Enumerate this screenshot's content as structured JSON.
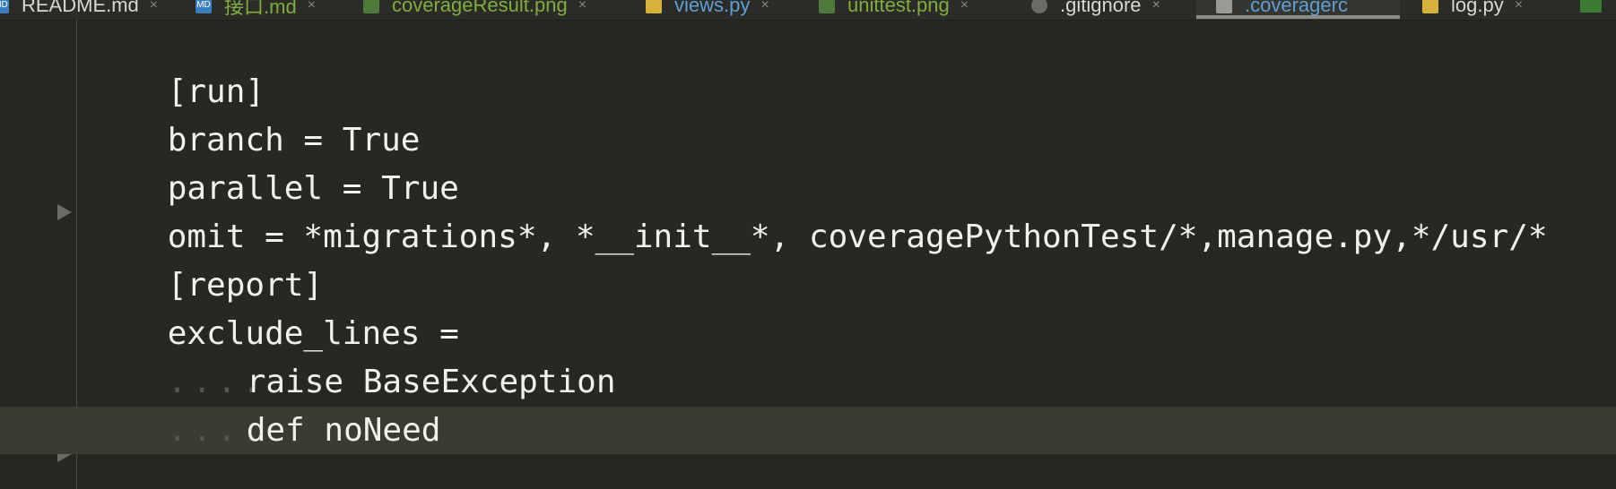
{
  "tabs": [
    {
      "label": "README.md",
      "icon": "markdown-icon",
      "icon_text": "MD",
      "style": "plain"
    },
    {
      "label": "接口.md",
      "icon": "markdown-icon",
      "icon_text": "MD",
      "style": "green"
    },
    {
      "label": "coverageResult.png",
      "icon": "image-icon",
      "icon_text": "",
      "style": "green"
    },
    {
      "label": "views.py",
      "icon": "python-icon",
      "icon_text": "",
      "style": "blue"
    },
    {
      "label": "unittest.png",
      "icon": "image-icon",
      "icon_text": "",
      "style": "green"
    },
    {
      "label": ".gitignore",
      "icon": "gitignore-icon",
      "icon_text": "",
      "style": "plain"
    },
    {
      "label": ".coveragerc",
      "icon": "config-file-icon",
      "icon_text": "",
      "style": "blue",
      "active": true
    },
    {
      "label": "log.py",
      "icon": "python-icon",
      "icon_text": "",
      "style": "plain"
    }
  ],
  "tab_close_glyph": "×",
  "code_lines": [
    {
      "text": "[run]"
    },
    {
      "text": "branch = True"
    },
    {
      "text": "parallel = True"
    },
    {
      "text": "omit = *migrations*, *__init__*, coveragePythonTest/*,manage.py,*/usr/*"
    },
    {
      "text": "[report]"
    },
    {
      "text": "exclude_lines ="
    },
    {
      "text": "raise BaseException",
      "indented": true
    },
    {
      "text": "def noNeed",
      "indented": true
    },
    {
      "text": ""
    }
  ],
  "indent_marker": "....",
  "colors": {
    "background": "#272822",
    "current_line": "#3b3b31",
    "text": "#f1f1ea"
  }
}
